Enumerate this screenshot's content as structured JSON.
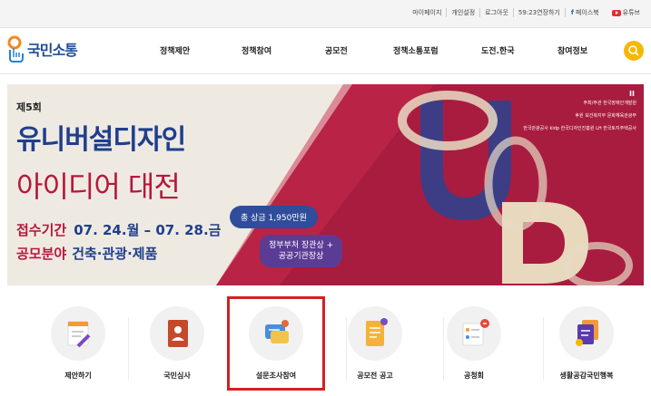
{
  "util_bar": {
    "links": [
      "마이페이지",
      "개인설정",
      "로그아웃",
      "59:23연장하기"
    ],
    "facebook_label": "페이스북",
    "youtube_label": "유튜브"
  },
  "header": {
    "logo_text": "국민소통",
    "menu": [
      "정책제안",
      "정책참여",
      "공모전",
      "정책소통포럼",
      "도전.한국",
      "참여정보"
    ]
  },
  "banner": {
    "round": "제5회",
    "title_line1": "유니버설디자인",
    "title_line2": "아이디어 대전",
    "period_label": "접수기간",
    "period_value": "07. 24.월 – 07. 28.금",
    "field_label": "공모분야",
    "field_value": "건축·관광·제품",
    "prize_bubble": "총 상금 1,950만원",
    "award_bubble_line1": "정부부처 장관상 +",
    "award_bubble_line2": "공공기관장상",
    "sponsor_host": "주최/주관",
    "sponsor_host_org": "한국장애인개발원",
    "sponsor_support": "후원",
    "sponsor_orgs": [
      "보건복지부",
      "문화체육관광부",
      "한국관광공사",
      "kidp 한국디자인진흥원",
      "LH 한국토지주택공사"
    ],
    "pause_label": "II"
  },
  "quick_menu": [
    {
      "label": "제안하기",
      "icon": "pencil-doc-icon"
    },
    {
      "label": "국민심사",
      "icon": "person-book-icon"
    },
    {
      "label": "설문조사참여",
      "icon": "chat-survey-icon"
    },
    {
      "label": "공모전 공고",
      "icon": "notice-doc-icon"
    },
    {
      "label": "공청회",
      "icon": "checklist-icon"
    },
    {
      "label": "생활공감국민행복",
      "icon": "stacked-docs-icon"
    }
  ],
  "colors": {
    "brand_blue": "#1f4e9a",
    "banner_red": "#b6173d",
    "highlight": "#d32020",
    "search_yellow": "#f5b800"
  }
}
